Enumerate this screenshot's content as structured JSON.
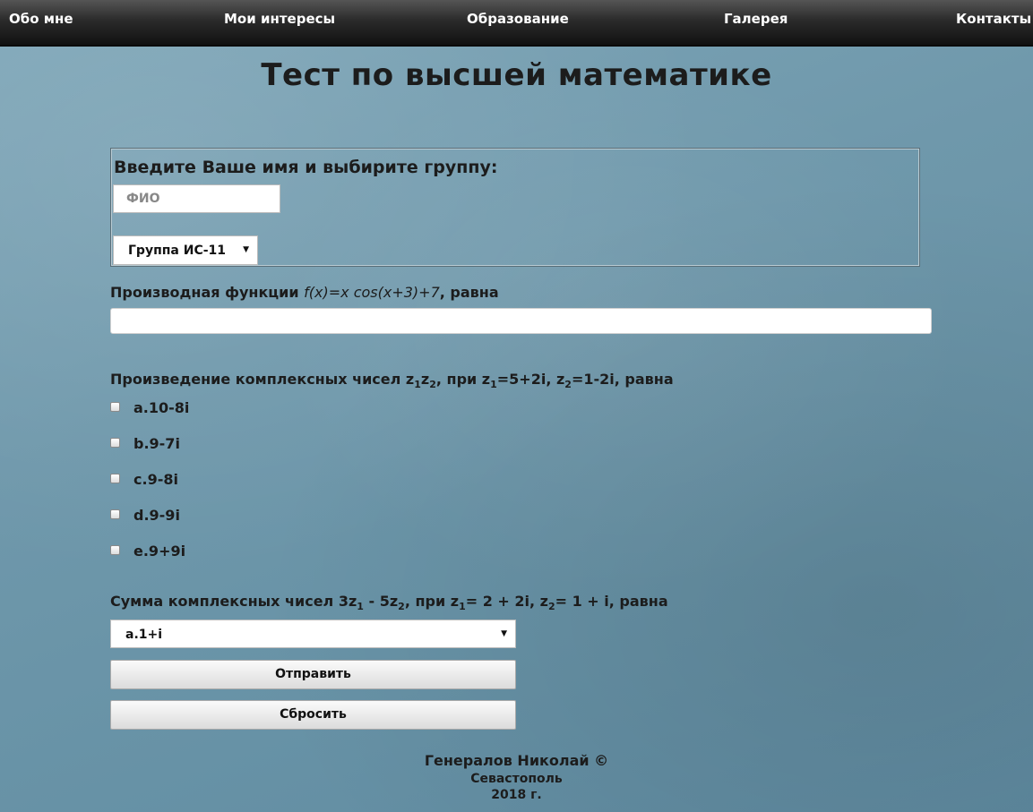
{
  "nav": {
    "items": [
      {
        "label": "Обо мне"
      },
      {
        "label": "Мои интересы"
      },
      {
        "label": "Образование"
      },
      {
        "label": "Галерея"
      },
      {
        "label": "Контакты"
      }
    ]
  },
  "page": {
    "title": "Тест по высшей математике"
  },
  "identity": {
    "legend": "Введите Ваше имя и выбирите группу:",
    "name_placeholder": "ФИО",
    "name_value": "",
    "group_value": "Группа ИС-11"
  },
  "question1": {
    "text_before": "Производная функции ",
    "formula": "f(x)=x cos(x+3)+7",
    "text_after": ", равна",
    "answer_value": ""
  },
  "question2": {
    "p1": "Произведение комплексных чисел z",
    "s1": "1",
    "p2": "z",
    "s2": "2",
    "p3": ", при z",
    "s3": "1",
    "p4": "=5+2i, z",
    "s4": "2",
    "p5": "=1-2i, равна",
    "options": [
      {
        "label": "a.10-8i",
        "checked": false
      },
      {
        "label": "b.9-7i",
        "checked": false
      },
      {
        "label": "c.9-8i",
        "checked": false
      },
      {
        "label": "d.9-9i",
        "checked": false
      },
      {
        "label": "e.9+9i",
        "checked": false
      }
    ]
  },
  "question3": {
    "p1": "Сумма комплексных чисел 3z",
    "s1": "1",
    "p2": " - 5z",
    "s2": "2",
    "p3": ", при z",
    "s3": "1",
    "p4": "= 2 + 2i, z",
    "s4": "2",
    "p5": "= 1 + i, равна",
    "selected": "a.1+i"
  },
  "buttons": {
    "submit": "Отправить",
    "reset": "Сбросить"
  },
  "footer": {
    "author": "Генералов Николай ©",
    "city": "Севастополь",
    "year": "2018 г."
  },
  "icons": {
    "dropdown": "chevron-down-icon",
    "checkbox": "checkbox-unchecked"
  },
  "colors": {
    "navbar": "#2b2b2b",
    "background": "#6f98ab",
    "text": "#1c1c1c"
  }
}
